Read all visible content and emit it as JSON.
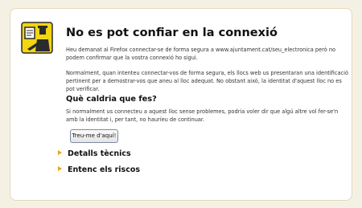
{
  "error_page": {
    "title": "No es pot confiar en la connexió",
    "intro": "Heu demanat al Firefox connectar-se de forma segura a www.ajuntament.cat/seu_electronica però no podem confirmar que la vostra connexió ho sigui.",
    "normal_text": "Normalment, quan intenteu connectar-vos de forma segura, els llocs web us presentaran una identificació pertinent per a demostrar-vos que aneu al lloc adequat. No obstant això, la identitat d'aquest lloc no es pot verificar.",
    "what_heading": "Què caldria que fes?",
    "what_text": "Si normalment us connecteu a aquest lloc sense problemes, podria voler dir que algú altre vol fer-se'n amb la identitat i, per tant, no hauríeu de continuar.",
    "get_me_out_label": "Treu-me d'aquí!",
    "technical_details_label": "Detalls tècnics",
    "understand_risks_label": "Entenc els riscos",
    "icon": "security-warning-officer-icon"
  }
}
